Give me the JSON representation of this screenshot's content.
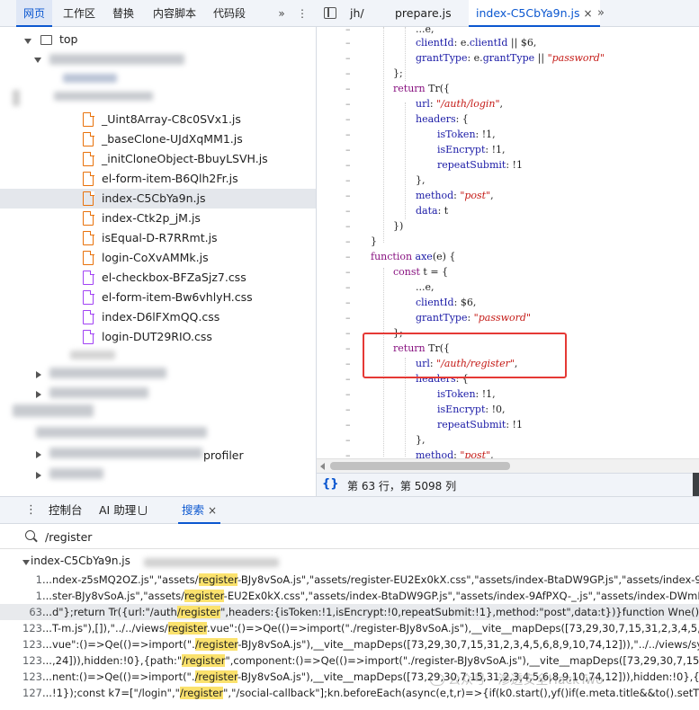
{
  "left_tabs": [
    "网页",
    "工作区",
    "替换",
    "内容脚本",
    "代码段"
  ],
  "left_more": "»",
  "kebab": "⋮",
  "tree": {
    "top_label": "top",
    "files": [
      {
        "name": "_Uint8Array-C8c0SVx1.js",
        "type": "js"
      },
      {
        "name": "_baseClone-UJdXqMM1.js",
        "type": "js"
      },
      {
        "name": "_initCloneObject-BbuyLSVH.js",
        "type": "js"
      },
      {
        "name": "el-form-item-B6Qlh2Fr.js",
        "type": "js"
      },
      {
        "name": "index-C5CbYa9n.js",
        "type": "js",
        "selected": true
      },
      {
        "name": "index-Ctk2p_jM.js",
        "type": "js"
      },
      {
        "name": "isEqual-D-R7RRmt.js",
        "type": "js"
      },
      {
        "name": "login-CoXvAMMk.js",
        "type": "js"
      },
      {
        "name": "el-checkbox-BFZaSjz7.css",
        "type": "css"
      },
      {
        "name": "el-form-item-Bw6vhlyH.css",
        "type": "css"
      },
      {
        "name": "index-D6lFXmQQ.css",
        "type": "css"
      },
      {
        "name": "login-DUT29RIO.css",
        "type": "css"
      }
    ],
    "profiler_label": "profiler"
  },
  "editor_tabs": [
    {
      "label": "jh/"
    },
    {
      "label": "prepare.js"
    },
    {
      "label": "index-C5CbYa9n.js",
      "active": true
    }
  ],
  "editor_close": "×",
  "editor_more": "»",
  "code": {
    "l1_rest": "e,",
    "l2_k": "clientId",
    "l2_v": "e.",
    "l2_v2": "clientId",
    "l2_v3": " || $6,",
    "l3_k": "grantType",
    "l3_v": "e.",
    "l3_v2": "grantType",
    "l3_v3": " || ",
    "l3_s": "\"password\"",
    "l4": "};",
    "l5_kw": "return",
    "l5_rest": " Tr({",
    "l6_k": "url",
    "l6_s": "\"/auth/login\"",
    "l7_k": "headers",
    "l8_k": "isToken",
    "l8_v": " !1,",
    "l9_k": "isEncrypt",
    "l9_v": " !1,",
    "l10_k": "repeatSubmit",
    "l10_v": " !1",
    "l11": "},",
    "l12_k": "method",
    "l12_s": "\"post\"",
    "l13_k": "data",
    "l13_v": " t",
    "l14": "})",
    "l15": "}",
    "l16_kw": "function",
    "l16_fn": "axe",
    "l16_rest": "(e) {",
    "l17_kw": "const",
    "l17_rest": " t = {",
    "l18_rest": "e,",
    "l19_k": "clientId",
    "l19_v": " $6,",
    "l20_k": "grantType",
    "l20_s": "\"password\"",
    "l21": "};",
    "l22_kw": "return",
    "l22_rest": " Tr({",
    "l23_k": "url",
    "l23_s": "\"/auth/register\"",
    "l24_k": "headers",
    "l25_k": "isToken",
    "l25_v": " !1,",
    "l26_k": "isEncrypt",
    "l26_v": " !0,",
    "l27_k": "repeatSubmit",
    "l27_v": " !1",
    "l28": "},",
    "l29_k": "method",
    "l29_s": "\"post\""
  },
  "status": {
    "icon": "{}",
    "position": "第 63 行，第 5098 列"
  },
  "drawer_tabs": [
    {
      "label": "控制台"
    },
    {
      "label": "AI 助理"
    },
    {
      "label": "搜索",
      "active": true
    }
  ],
  "drawer_close": "×",
  "search": {
    "query": "/register"
  },
  "results": {
    "file": "index-C5CbYa9n.js",
    "rows": [
      {
        "ln": "1",
        "pre": "...ndex-z5sMQ2OZ.js\",\"assets/",
        "hit": "register",
        "post": "-BJy8vSoA.js\",\"assets/register-EU2Ex0kX.css\",\"assets/index-BtaDW9GP.js\",\"assets/index-9A"
      },
      {
        "ln": "1",
        "pre": "...ster-BJy8vSoA.js\",\"assets/",
        "hit": "register",
        "post": "-EU2Ex0kX.css\",\"assets/index-BtaDW9GP.js\",\"assets/index-9AfPXQ-_.js\",\"assets/index-DWmIP"
      },
      {
        "ln": "63",
        "pre": "...d\"};return Tr({url:\"/auth",
        "hit": "/register",
        "post": "\",headers:{isToken:!1,isEncrypt:!0,repeatSubmit:!1},method:\"post\",data:t})}function Wne(){retur",
        "selected": true
      },
      {
        "ln": "123",
        "pre": "...T-m.js\"),[]),\"../../views/",
        "hit": "register",
        "post": ".vue\":()=>Qe(()=>import(\"./register-BJy8vSoA.js\"),__vite__mapDeps([73,29,30,7,15,31,2,3,4,5,6,8"
      },
      {
        "ln": "123",
        "pre": "...vue\":()=>Qe(()=>import(\".",
        "hit": "/register",
        "post": "-BJy8vSoA.js\"),__vite__mapDeps([73,29,30,7,15,31,2,3,4,5,6,8,9,10,74,12])),\"../../views/syste"
      },
      {
        "ln": "123",
        "pre": "...,24])),hidden:!0},{path:\"",
        "hit": "/register",
        "post": "\",component:()=>Qe(()=>import(\"./register-BJy8vSoA.js\"),__vite__mapDeps([73,29,30,7,15,31"
      },
      {
        "ln": "123",
        "pre": "...nent:()=>Qe(()=>import(\".",
        "hit": "/register",
        "post": "-BJy8vSoA.js\"),__vite__mapDeps([73,29,30,7,15,31,2,3,4,5,6,8,9,10,74,12])),hidden:!0},{path"
      },
      {
        "ln": "127",
        "pre": "...!1});const k7=[\"/login\",\"",
        "hit": "/register",
        "post": "\",\"/social-callback\"];kn.beforeEach(async(e,t,r)=>{if(k0.start(),yf()if(e.meta.title&&to().setTitl"
      }
    ]
  },
  "watermark": "公众号 · 渗透安全HackTwo"
}
